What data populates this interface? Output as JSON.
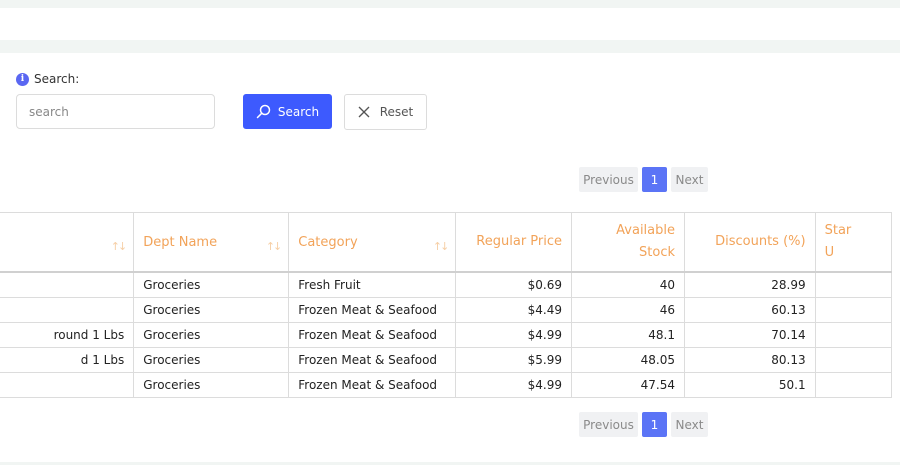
{
  "search": {
    "label": "Search:",
    "placeholder": "search",
    "button_label": "Search",
    "reset_label": "Reset"
  },
  "pagination": {
    "previous": "Previous",
    "current": "1",
    "next": "Next"
  },
  "table": {
    "columns": [
      "",
      "Dept Name",
      "Category",
      "Regular Price",
      "Available Stock",
      "Discounts (%)",
      "Star U"
    ],
    "rows": [
      [
        "",
        "Groceries",
        "Fresh Fruit",
        "$0.69",
        "40",
        "28.99",
        ""
      ],
      [
        "",
        "Groceries",
        "Frozen Meat & Seafood",
        "$4.49",
        "46",
        "60.13",
        ""
      ],
      [
        "round 1 Lbs",
        "Groceries",
        "Frozen Meat & Seafood",
        "$4.99",
        "48.1",
        "70.14",
        ""
      ],
      [
        "d 1 Lbs",
        "Groceries",
        "Frozen Meat & Seafood",
        "$5.99",
        "48.05",
        "80.13",
        ""
      ],
      [
        "",
        "Groceries",
        "Frozen Meat & Seafood",
        "$4.99",
        "47.54",
        "50.1",
        ""
      ]
    ]
  },
  "colors": {
    "accent": "#3d5afe",
    "header_text": "#f2a359",
    "page_active": "#5b74f6"
  }
}
